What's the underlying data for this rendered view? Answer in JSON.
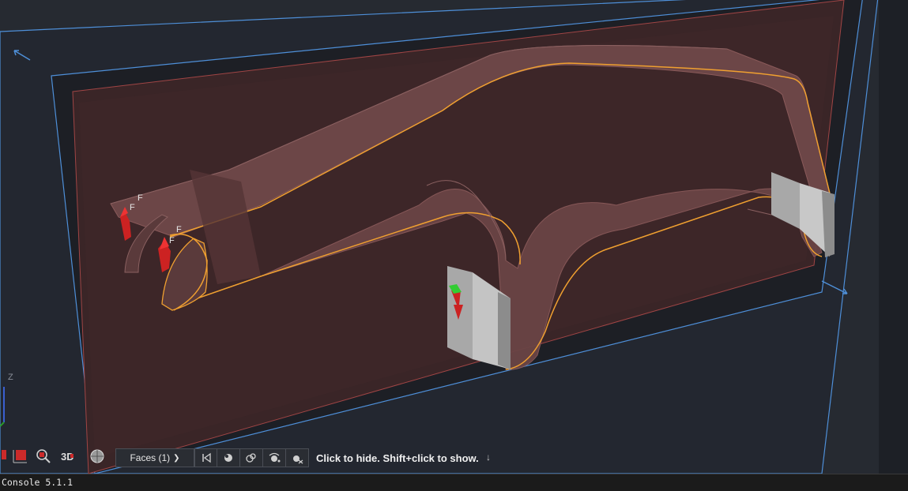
{
  "viewport": {
    "axis_label": "Z",
    "load_label_1": "F",
    "load_label_2": "F",
    "load_label_3": "F",
    "load_label_4": "F"
  },
  "toolbar": {
    "selection_filter": "Faces (1)",
    "hint": "Click to hide. Shift+click to show."
  },
  "console": {
    "title": "Console 5.1.1"
  },
  "colors": {
    "background": "#1d2026",
    "enclosure_fill": "#3c2626",
    "body_fill": "#6a4545",
    "selection_outline": "#f0a030",
    "bounding_edge": "#4e8fd8",
    "end_cap": "#b4b4b4",
    "load_arrow": "#cc2222",
    "fixed_support": "#33cc33"
  }
}
